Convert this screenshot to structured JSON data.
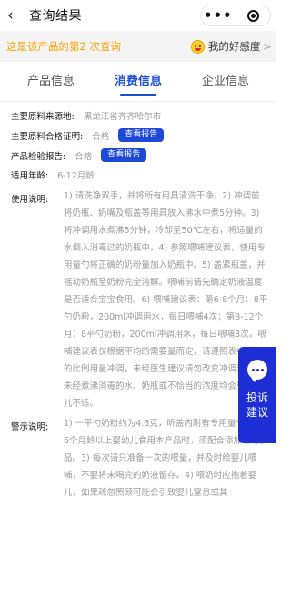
{
  "nav": {
    "back_icon": "chevron-left-icon",
    "title": "查询结果",
    "more": "•••"
  },
  "notice": {
    "prefix": "这是该产品的第",
    "count": "2",
    "suffix": "次查询",
    "rating_label": "我的好感度",
    "chevron": ">"
  },
  "tabs": [
    {
      "label": "产品信息",
      "active": false
    },
    {
      "label": "消费信息",
      "active": true
    },
    {
      "label": "企业信息",
      "active": false
    }
  ],
  "fields": {
    "origin": {
      "label": "主要原料来源地:",
      "value": "黑龙江省齐齐哈尔市"
    },
    "material_cert": {
      "label": "主要原料合格证明:",
      "value": "合格",
      "button": "查看报告"
    },
    "inspection": {
      "label": "产品检验报告:",
      "value": "合格",
      "button": "查看报告"
    },
    "age": {
      "label": "适用年龄:",
      "value": "6-12月龄"
    },
    "usage": {
      "label": "使用说明:",
      "value": "1) 请洗净双手，并将所有用具清洗干净。2) 冲调前将奶瓶、奶嘴及瓶盖等用具放入沸水中煮5分钟。3) 将冲调用水煮沸5分钟，冷却至50℃左右，将适量的水倒入消毒过的奶瓶中。4) 参照喂哺建议表，使用专用量勺将正确的奶粉量加入奶瓶中。5) 盖紧瓶盖，并摇动奶瓶至奶粉完全溶解。喂哺前请先确定奶液温度是否适合宝宝食用。6) 喂哺建议表：第6-8个月：8平勺奶粉，200ml冲调用水，每日喂哺4次；第8-12个月：8平勺奶粉，200ml冲调用水，每日喂哺3次。喂哺建议表仅根据平均的需要量而定，请遵照表中所示的比例用量冲调，未经医生建议请勿改变冲调浓度。未经煮沸消毒的水、奶瓶或不恰当的浓度均会引起婴儿不适。"
    },
    "warning": {
      "label": "警示说明:",
      "value": "1) 一平勺奶粉约为4.3克，听盖内附有专用量勺。2) 6个月龄以上婴幼儿食用本产品时，须配合添加辅助食品。3) 每次请只准备一次的喂量，并及时给婴儿喂哺，不要将未喝完的奶液留存。4) 喂奶时应抱着婴儿，如果疏忽照顾可能会引致婴儿窒息或其"
    }
  },
  "float_button": {
    "icon": "chat-bubble-icon",
    "line1": "投诉",
    "line2": "建议"
  },
  "colors": {
    "accent": "#1a4fd6",
    "notice_text": "#f5a300",
    "float_bg": "#1d2fd4"
  }
}
